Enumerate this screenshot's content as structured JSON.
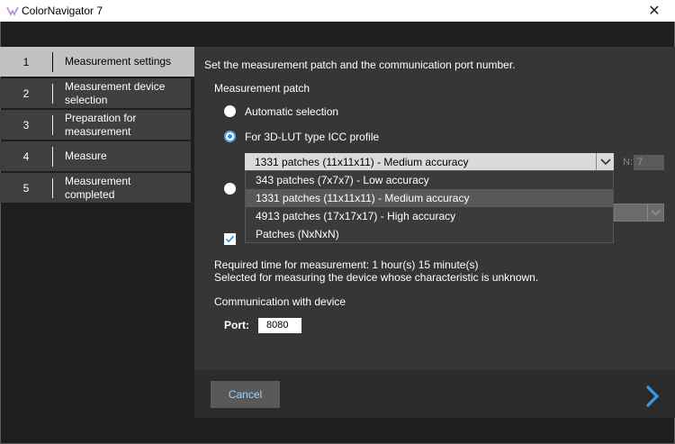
{
  "window": {
    "title": "ColorNavigator 7"
  },
  "steps": [
    {
      "number": "1",
      "label": "Measurement settings"
    },
    {
      "number": "2",
      "label": "Measurement device selection"
    },
    {
      "number": "3",
      "label": "Preparation for measurement"
    },
    {
      "number": "4",
      "label": "Measure"
    },
    {
      "number": "5",
      "label": "Measurement completed"
    }
  ],
  "main": {
    "instruction": "Set the measurement patch and the communication port number.",
    "patch_heading": "Measurement patch",
    "option_auto": "Automatic selection",
    "option_3dlut": "For 3D-LUT type ICC profile",
    "patch_select_value": "1331 patches (11x11x11) - Medium accuracy",
    "n_label": "N:",
    "n_value": "7",
    "dropdown_options": [
      "343 patches (7x7x7) - Low accuracy",
      "1331 patches (11x11x11) - Medium accuracy",
      "4913 patches (17x17x17) - High accuracy",
      "Patches (NxNxN)"
    ],
    "required_time": "Required time for measurement: 1 hour(s) 15 minute(s)",
    "selected_note": "Selected for measuring the device whose characteristic is unknown.",
    "comm_heading": "Communication with device",
    "port_label": "Port:",
    "port_value": "8080"
  },
  "footer": {
    "cancel_label": "Cancel"
  },
  "colors": {
    "accent": "#2f8fd8",
    "active_step": "#c2c2c2"
  }
}
